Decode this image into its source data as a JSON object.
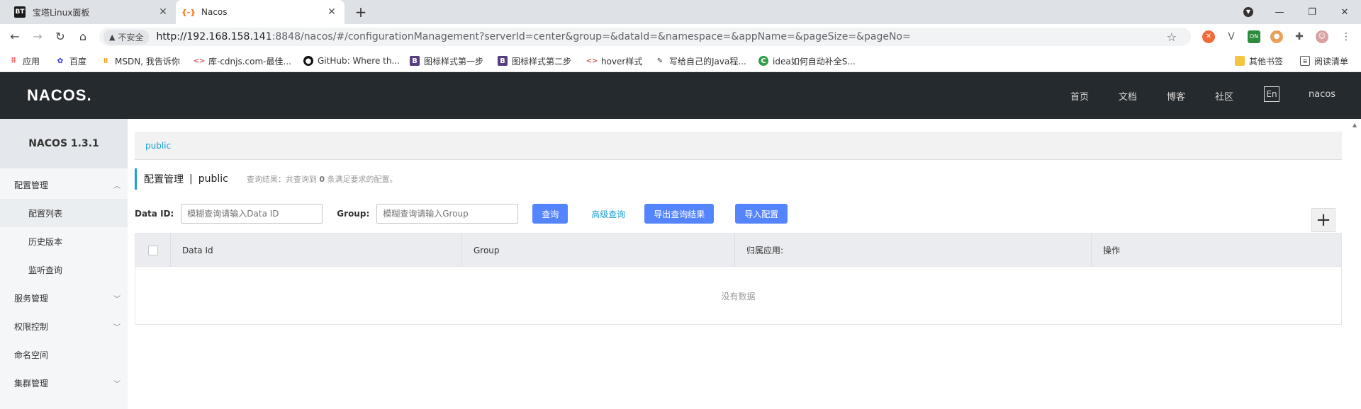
{
  "browser": {
    "tabs": [
      {
        "favicon": "BT",
        "title": "宝塔Linux面板"
      },
      {
        "favicon": "{-}",
        "title": "Nacos"
      }
    ],
    "url": {
      "security_label": "不安全",
      "host": "http://192.168.158.141",
      "rest": ":8848/nacos/#/configurationManagement?serverId=center&group=&dataId=&namespace=&appName=&pageSize=&pageNo="
    },
    "bookmarks": [
      {
        "icon": "apps",
        "label": "应用"
      },
      {
        "icon": "baidu",
        "label": "百度"
      },
      {
        "icon": "msdn",
        "label": "MSDN, 我告诉你"
      },
      {
        "icon": "code",
        "label": "库-cdnjs.com-最佳..."
      },
      {
        "icon": "github",
        "label": "GitHub: Where th..."
      },
      {
        "icon": "bootstrap",
        "label": "图标样式第一步"
      },
      {
        "icon": "bootstrap",
        "label": "图标样式第二步"
      },
      {
        "icon": "code",
        "label": "hover样式"
      },
      {
        "icon": "pen",
        "label": "写给自己的Java程..."
      },
      {
        "icon": "idea",
        "label": "idea如何自动补全S..."
      }
    ],
    "other_bookmarks": "其他书签",
    "reading_list": "阅读清单"
  },
  "app": {
    "logo": "NACOS.",
    "nav": [
      "首页",
      "文档",
      "博客",
      "社区"
    ],
    "lang": "En",
    "user": "nacos",
    "version": "NACOS 1.3.1",
    "menu": [
      {
        "label": "配置管理",
        "type": "top",
        "chevron": "up"
      },
      {
        "label": "配置列表",
        "type": "sub",
        "selected": true
      },
      {
        "label": "历史版本",
        "type": "sub"
      },
      {
        "label": "监听查询",
        "type": "sub"
      },
      {
        "label": "服务管理",
        "type": "top",
        "chevron": "down"
      },
      {
        "label": "权限控制",
        "type": "top",
        "chevron": "down"
      },
      {
        "label": "命名空间",
        "type": "top"
      },
      {
        "label": "集群管理",
        "type": "top",
        "chevron": "down"
      }
    ],
    "breadcrumb": "public",
    "page_title": "配置管理",
    "page_namespace": "public",
    "result_prefix": "查询结果：共查询到",
    "result_count": "0",
    "result_suffix": "条满足要求的配置。",
    "filters": {
      "dataid_label": "Data ID:",
      "dataid_placeholder": "模糊查询请输入Data ID",
      "group_label": "Group:",
      "group_placeholder": "模糊查询请输入Group",
      "query": "查询",
      "advanced": "高级查询",
      "export": "导出查询结果",
      "import": "导入配置"
    },
    "table": {
      "columns": [
        "Data Id",
        "Group",
        "归属应用:",
        "操作"
      ],
      "empty": "没有数据"
    }
  }
}
